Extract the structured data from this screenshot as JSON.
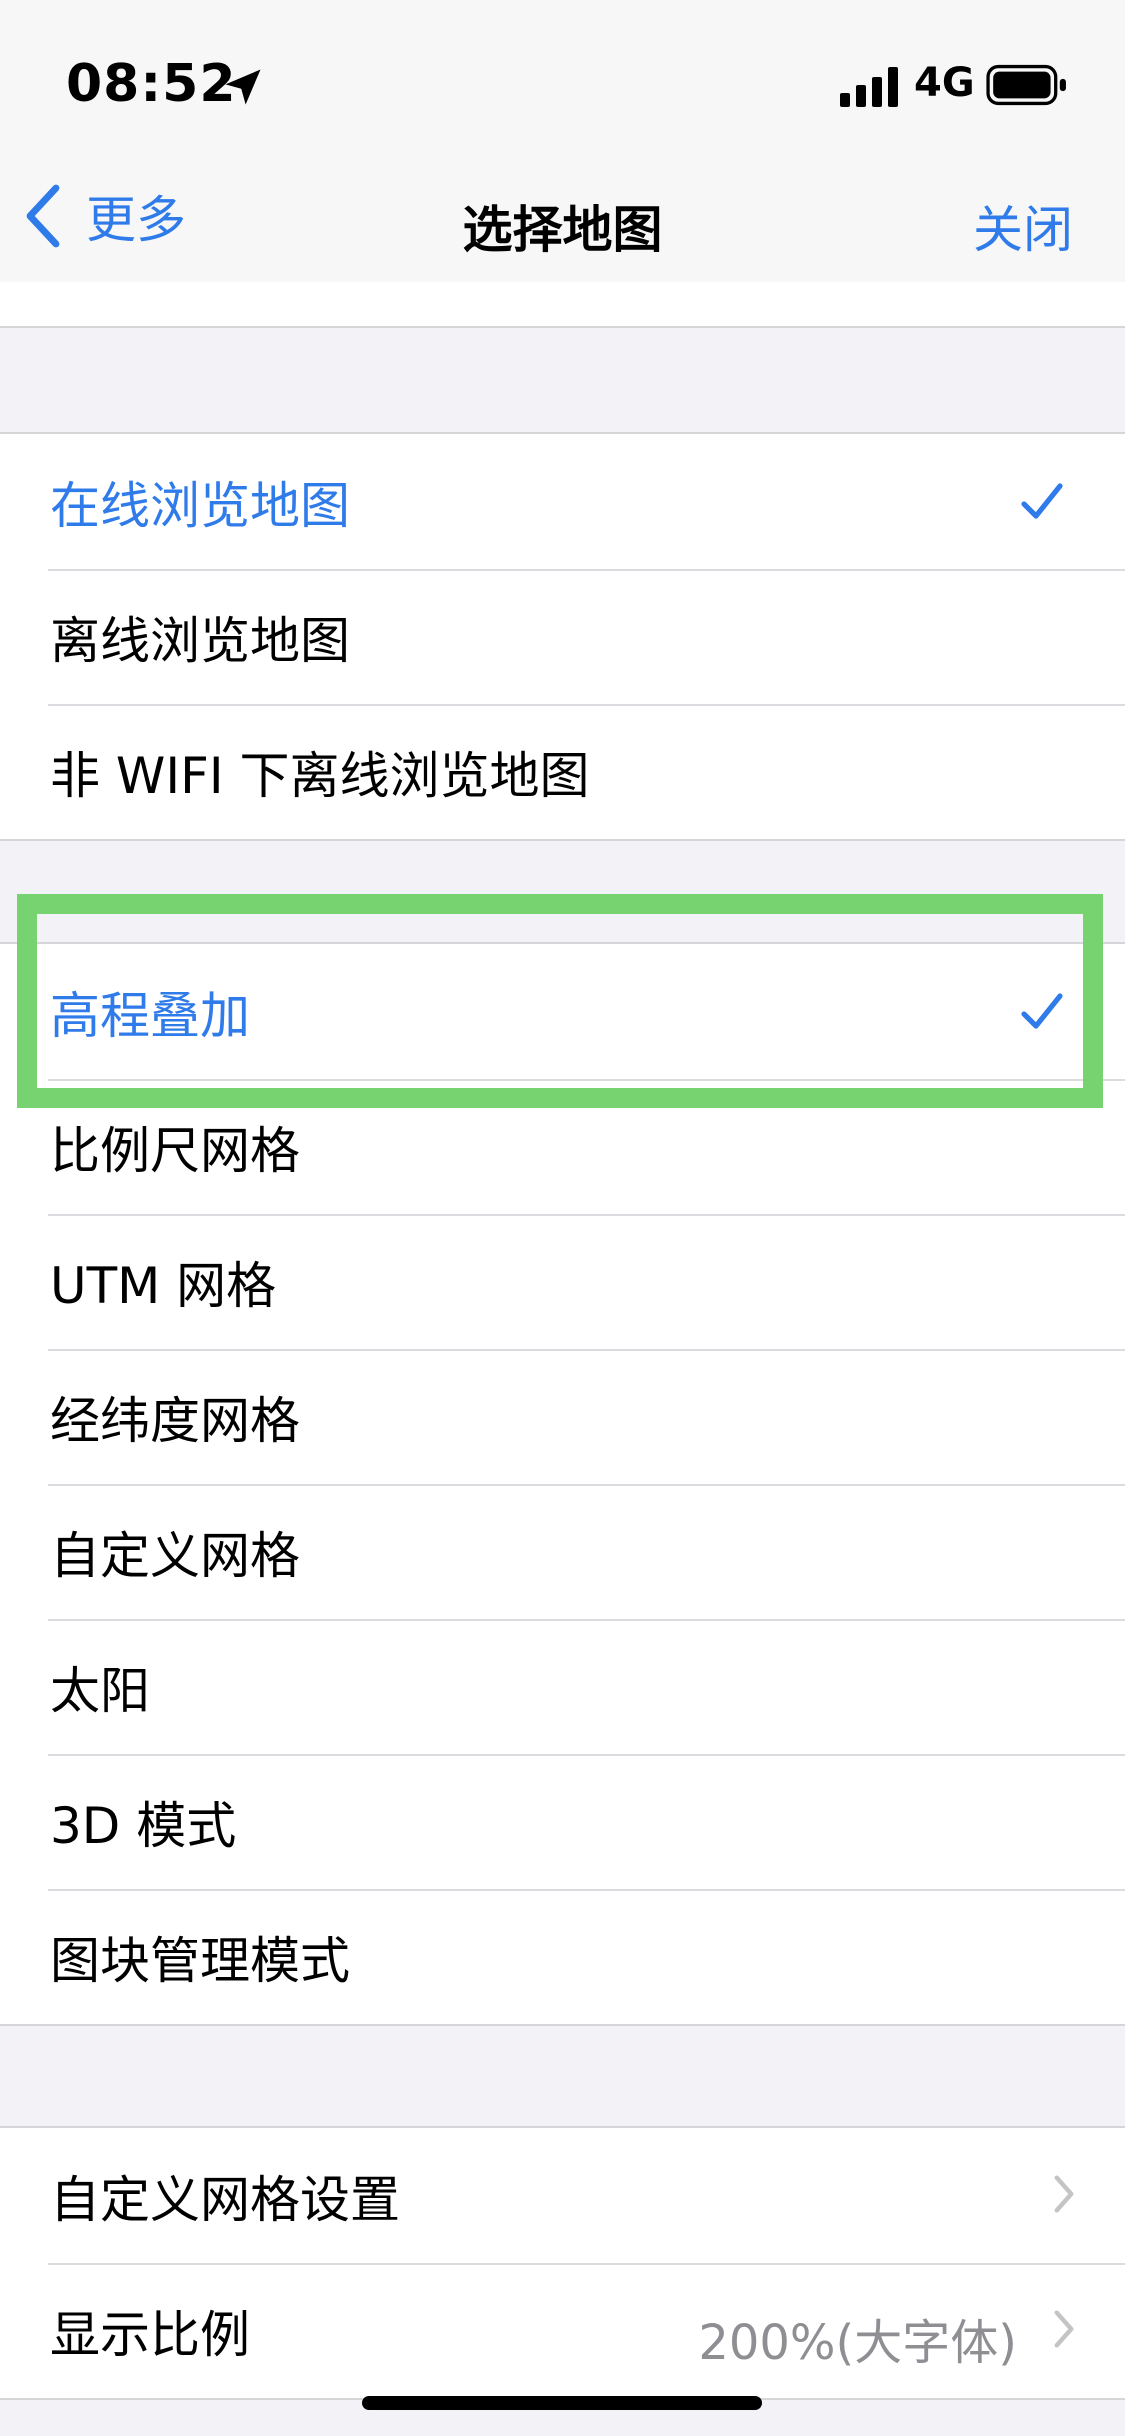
{
  "status_bar": {
    "time": "08:52",
    "network": "4G",
    "icons": [
      "location-arrow-icon",
      "signal-bars-icon",
      "battery-icon"
    ]
  },
  "nav": {
    "back_label": "更多",
    "title": "选择地图",
    "close_label": "关闭",
    "icons": [
      "chevron-left-icon"
    ]
  },
  "groups": {
    "browse": [
      {
        "label": "在线浏览地图",
        "selected": true
      },
      {
        "label": "离线浏览地图",
        "selected": false
      },
      {
        "label": "非 WIFI 下离线浏览地图",
        "selected": false
      }
    ],
    "overlays": [
      {
        "label": "高程叠加",
        "selected": true
      },
      {
        "label": "比例尺网格",
        "selected": false
      },
      {
        "label": "UTM 网格",
        "selected": false
      },
      {
        "label": "经纬度网格",
        "selected": false
      },
      {
        "label": "自定义网格",
        "selected": false
      },
      {
        "label": "太阳",
        "selected": false
      },
      {
        "label": "3D 模式",
        "selected": false
      },
      {
        "label": "图块管理模式",
        "selected": false
      }
    ],
    "settings": [
      {
        "label": "自定义网格设置",
        "detail": ""
      },
      {
        "label": "显示比例",
        "detail": "200%(大字体)"
      }
    ]
  },
  "colors": {
    "accent": "#2f7bea",
    "highlight": "#77d36f",
    "background": "#f2f2f7"
  }
}
